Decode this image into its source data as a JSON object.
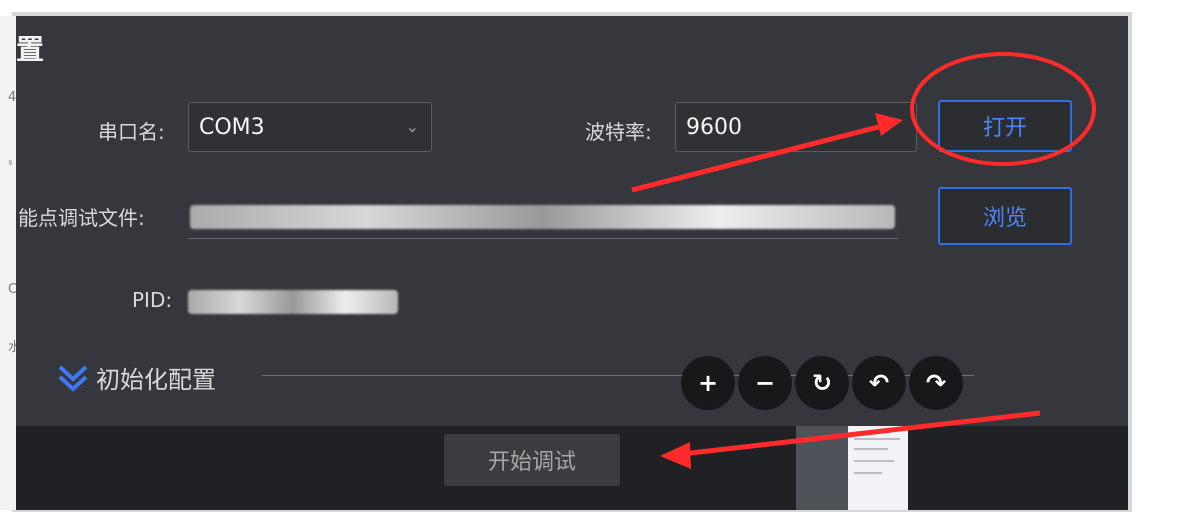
{
  "window": {
    "title_partial": "置"
  },
  "form": {
    "serial_port_label": "串口名:",
    "serial_port_value": "COM3",
    "baud_rate_label": "波特率:",
    "baud_rate_value": "9600",
    "file_label": "能点调试文件:",
    "pid_label": "PID:"
  },
  "buttons": {
    "open": "打开",
    "browse": "浏览",
    "start_debug": "开始调试"
  },
  "section": {
    "init_config": "初始化配置"
  },
  "toolbar": {
    "zoom_in": "+",
    "zoom_out": "−",
    "reset": "↻",
    "undo": "↶",
    "redo": "↷"
  },
  "left_edge_chars": [
    "4",
    "ˢ",
    "C",
    "水"
  ],
  "icons": [
    "chevron-down-icon",
    "double-chevron-down-icon",
    "plus-icon",
    "minus-icon",
    "refresh-icon",
    "undo-icon",
    "redo-icon"
  ],
  "colors": {
    "accent": "#2f6ee8",
    "highlight": "#ff2a2a",
    "panel": "#35373c"
  }
}
